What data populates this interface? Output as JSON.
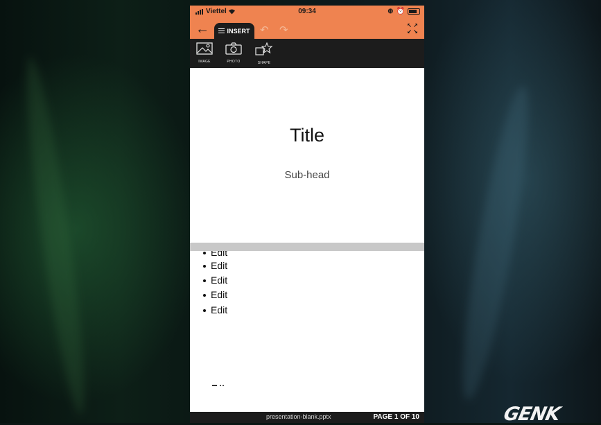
{
  "status": {
    "carrier": "Viettel",
    "time": "09:34"
  },
  "toolbar": {
    "tab_label": "INSERT"
  },
  "ribbon": {
    "items": [
      {
        "label": "IMAGE",
        "icon": "image-icon"
      },
      {
        "label": "PHOTO",
        "icon": "camera-icon"
      },
      {
        "label": "SHAPE",
        "icon": "shape-icon"
      }
    ]
  },
  "slide1": {
    "title": "Title",
    "subhead": "Sub-head"
  },
  "slide2": {
    "bullets": [
      "Edit",
      "Edit",
      "Edit",
      "Edit",
      "Edit"
    ]
  },
  "footer": {
    "filename": "presentation-blank.pptx",
    "page": "PAGE 1 OF 10"
  },
  "watermark": "GENK",
  "colors": {
    "accent": "#ef8350",
    "toolbar_dark": "#1c1c1c"
  }
}
